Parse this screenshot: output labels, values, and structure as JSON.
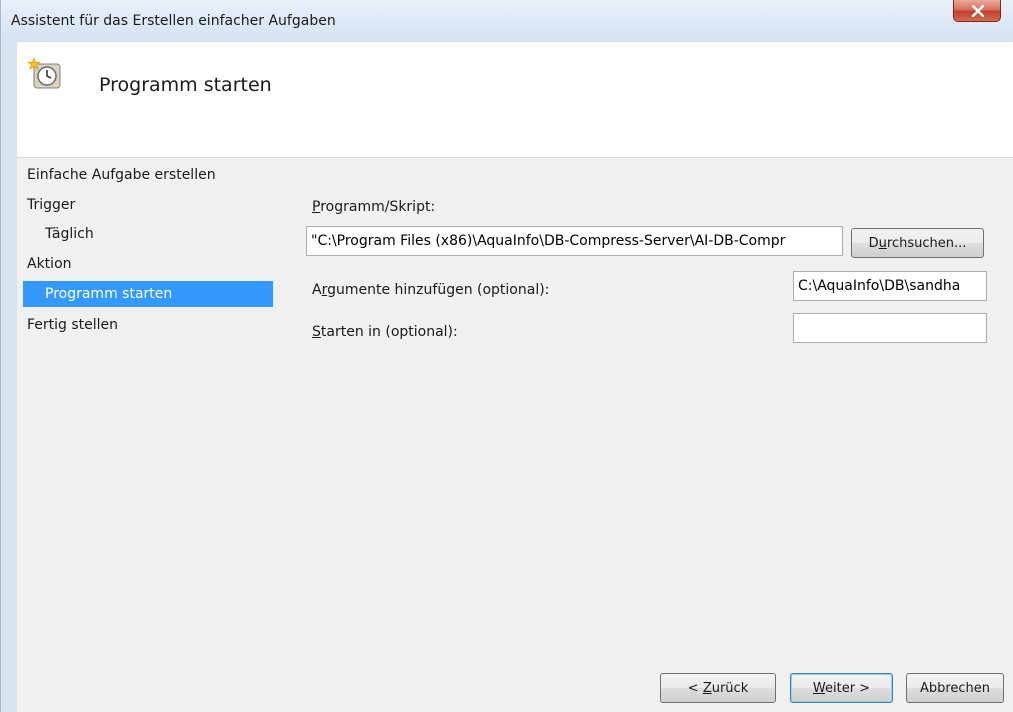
{
  "window": {
    "title": "Assistent für das Erstellen einfacher Aufgaben"
  },
  "header": {
    "title": "Programm starten"
  },
  "nav": {
    "items": [
      {
        "label": "Einfache Aufgabe erstellen",
        "indent": 0,
        "selected": false
      },
      {
        "label": "Trigger",
        "indent": 0,
        "selected": false
      },
      {
        "label": "Täglich",
        "indent": 1,
        "selected": false
      },
      {
        "label": "Aktion",
        "indent": 0,
        "selected": false
      },
      {
        "label": "Programm starten",
        "indent": 1,
        "selected": true
      },
      {
        "label": "Fertig stellen",
        "indent": 0,
        "selected": false
      }
    ]
  },
  "form": {
    "program_label_key": "P",
    "program_label_rest": "rogramm/Skript:",
    "program_value": "\"C:\\Program Files (x86)\\AquaInfo\\DB-Compress-Server\\AI-DB-Compr",
    "browse_key": "u",
    "browse_pre": "D",
    "browse_rest": "rchsuchen...",
    "args_pre": "A",
    "args_key": "r",
    "args_rest": "gumente hinzufügen (optional):",
    "args_value": "C:\\AquaInfo\\DB\\sandha",
    "startin_key": "S",
    "startin_rest": "tarten in (optional):",
    "startin_value": ""
  },
  "footer": {
    "back_pre": "< ",
    "back_key": "Z",
    "back_rest": "urück",
    "next_key": "W",
    "next_rest": "eiter >",
    "cancel_label": "Abbrechen"
  },
  "colors": {
    "selection": "#3399ff",
    "panel": "#f0f0f0",
    "titlebar": "#d5e2f1",
    "close": "#c1412a"
  },
  "icons": {
    "close": "close-x-icon",
    "header": "clock-task-icon"
  }
}
